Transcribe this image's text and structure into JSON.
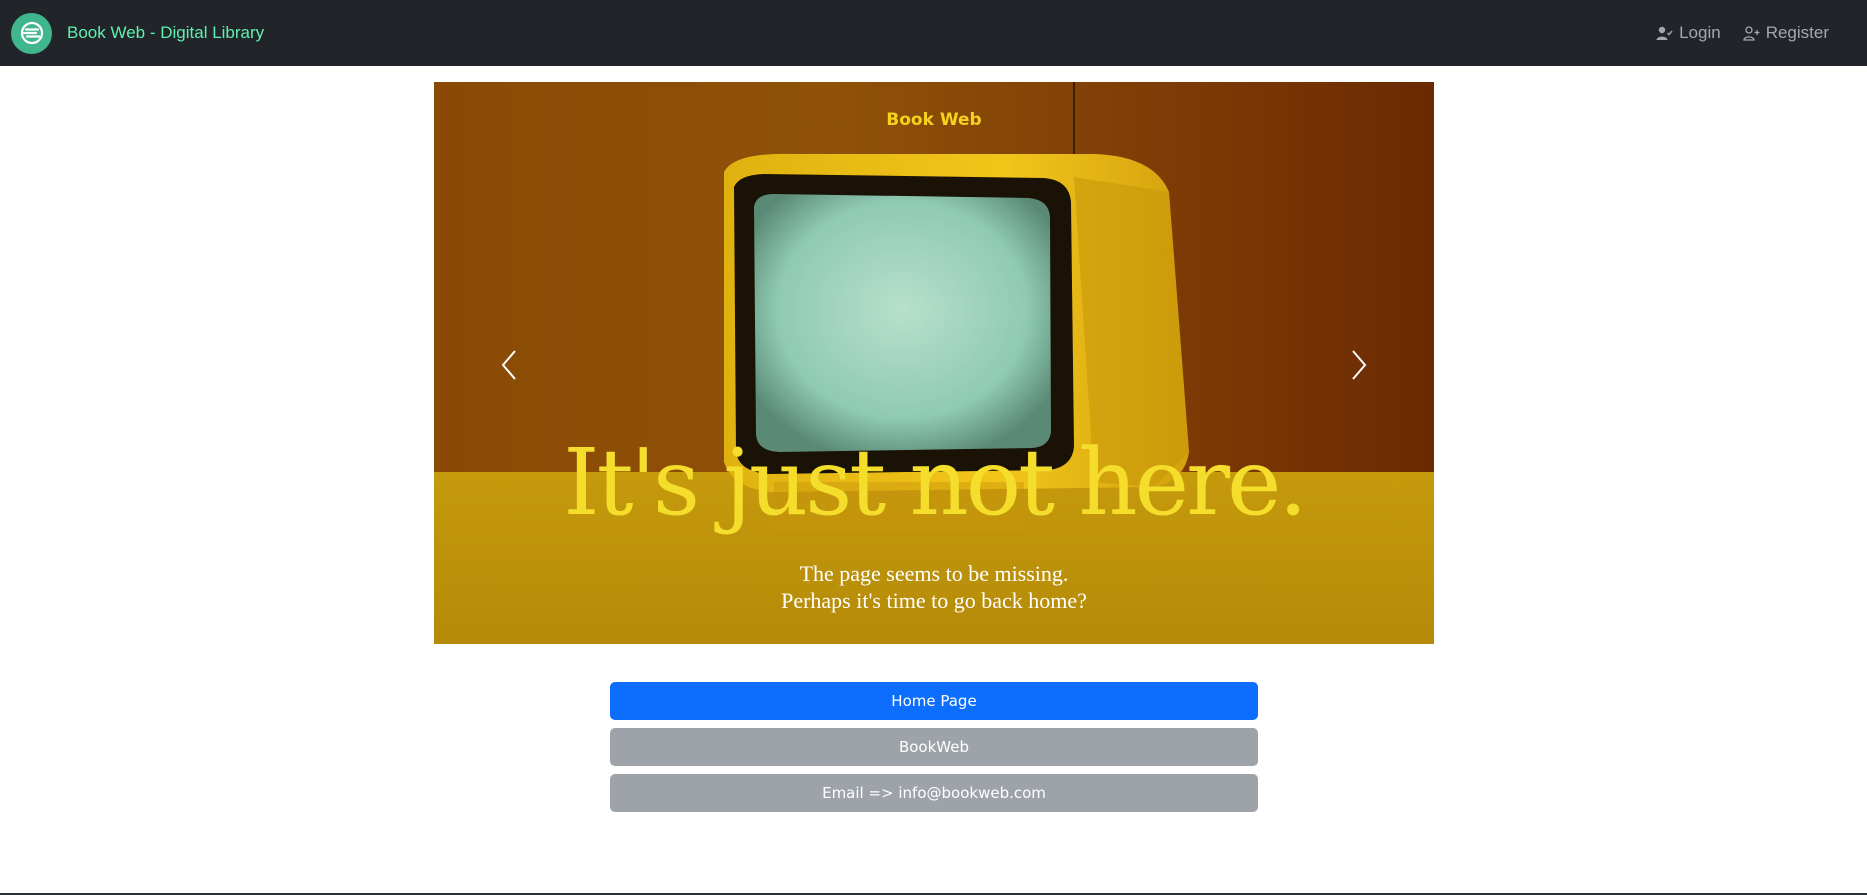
{
  "navbar": {
    "brand_text": "Book Web - Digital Library",
    "brand_icon": "stripes-circle-logo",
    "login_label": "Login",
    "register_label": "Register",
    "colors": {
      "background": "#212529",
      "brand": "#5ff0b0",
      "links": "#a3a8ad"
    }
  },
  "hero": {
    "brand": "Book Web",
    "title": "It's just not here.",
    "subtitle_line1": "The page seems to be missing.",
    "subtitle_line2": "Perhaps it's time to go back home?",
    "prev_icon": "chevron-left-icon",
    "next_icon": "chevron-right-icon"
  },
  "actions": {
    "home_label": "Home Page",
    "bookweb_label": "BookWeb",
    "email_label": "Email => info@bookweb.com",
    "colors": {
      "primary": "#0d6efd",
      "secondary": "#9da3a9"
    }
  }
}
